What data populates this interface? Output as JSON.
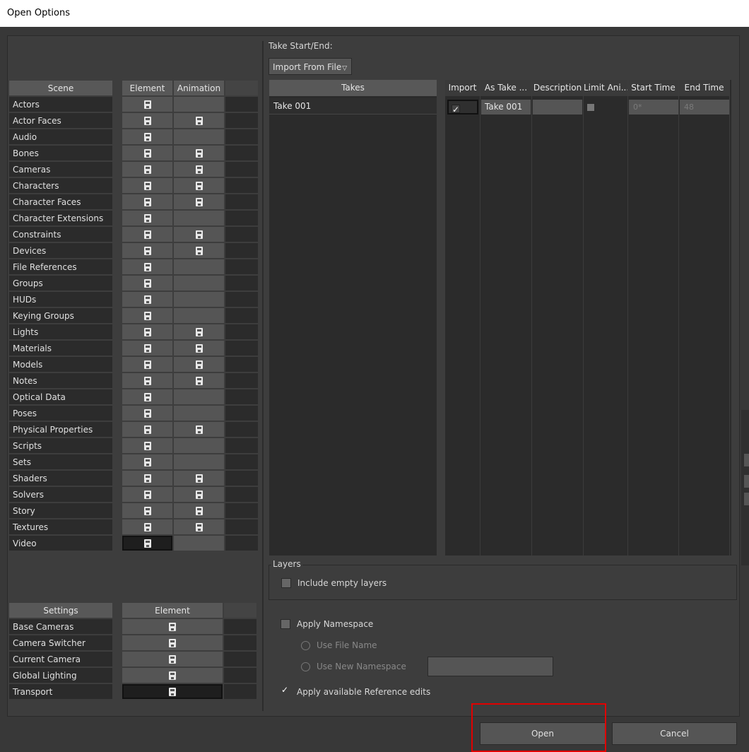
{
  "window": {
    "title": "Open Options"
  },
  "take_start_end": {
    "label": "Take Start/End:",
    "dropdown_value": "Import From File"
  },
  "scene": {
    "headers": {
      "scene": "Scene",
      "element": "Element",
      "animation": "Animation"
    },
    "rows": [
      {
        "label": "Actors",
        "element": true,
        "animation": false
      },
      {
        "label": "Actor Faces",
        "element": true,
        "animation": true
      },
      {
        "label": "Audio",
        "element": true,
        "animation": false
      },
      {
        "label": "Bones",
        "element": true,
        "animation": true
      },
      {
        "label": "Cameras",
        "element": true,
        "animation": true
      },
      {
        "label": "Characters",
        "element": true,
        "animation": true
      },
      {
        "label": "Character Faces",
        "element": true,
        "animation": true
      },
      {
        "label": "Character Extensions",
        "element": true,
        "animation": false
      },
      {
        "label": "Constraints",
        "element": true,
        "animation": true
      },
      {
        "label": "Devices",
        "element": true,
        "animation": true
      },
      {
        "label": "File References",
        "element": true,
        "animation": false
      },
      {
        "label": "Groups",
        "element": true,
        "animation": false
      },
      {
        "label": "HUDs",
        "element": true,
        "animation": false
      },
      {
        "label": "Keying Groups",
        "element": true,
        "animation": false
      },
      {
        "label": "Lights",
        "element": true,
        "animation": true
      },
      {
        "label": "Materials",
        "element": true,
        "animation": true
      },
      {
        "label": "Models",
        "element": true,
        "animation": true
      },
      {
        "label": "Notes",
        "element": true,
        "animation": true
      },
      {
        "label": "Optical Data",
        "element": true,
        "animation": false
      },
      {
        "label": "Poses",
        "element": true,
        "animation": false
      },
      {
        "label": "Physical Properties",
        "element": true,
        "animation": true
      },
      {
        "label": "Scripts",
        "element": true,
        "animation": false
      },
      {
        "label": "Sets",
        "element": true,
        "animation": false
      },
      {
        "label": "Shaders",
        "element": true,
        "animation": true
      },
      {
        "label": "Solvers",
        "element": true,
        "animation": true
      },
      {
        "label": "Story",
        "element": true,
        "animation": true
      },
      {
        "label": "Textures",
        "element": true,
        "animation": true
      },
      {
        "label": "Video",
        "element": true,
        "animation": false
      }
    ]
  },
  "settings": {
    "headers": {
      "settings": "Settings",
      "element": "Element"
    },
    "rows": [
      {
        "label": "Base Cameras"
      },
      {
        "label": "Camera Switcher"
      },
      {
        "label": "Current Camera"
      },
      {
        "label": "Global Lighting"
      },
      {
        "label": "Transport"
      }
    ]
  },
  "takes": {
    "header": "Takes",
    "items": [
      "Take 001"
    ]
  },
  "take_table": {
    "headers": [
      "Import",
      "As Take ...",
      "Description",
      "Limit Ani...",
      "Start Time",
      "End Time"
    ],
    "row": {
      "import_checked": true,
      "as_take": "Take 001",
      "description": "",
      "limit_checked": false,
      "start_time": "0*",
      "end_time": "48"
    }
  },
  "layers": {
    "title": "Layers",
    "include_empty_label": "Include empty layers",
    "include_empty_checked": false
  },
  "namespace": {
    "apply_label": "Apply Namespace",
    "apply_checked": false,
    "use_file_name_label": "Use File Name",
    "use_new_namespace_label": "Use New Namespace",
    "new_namespace_value": ""
  },
  "reference_edits": {
    "label": "Apply available Reference edits",
    "checked": true
  },
  "buttons": {
    "open": "Open",
    "cancel": "Cancel"
  },
  "colors": {
    "highlight": "#e00000",
    "background": "#3d3d3d"
  }
}
